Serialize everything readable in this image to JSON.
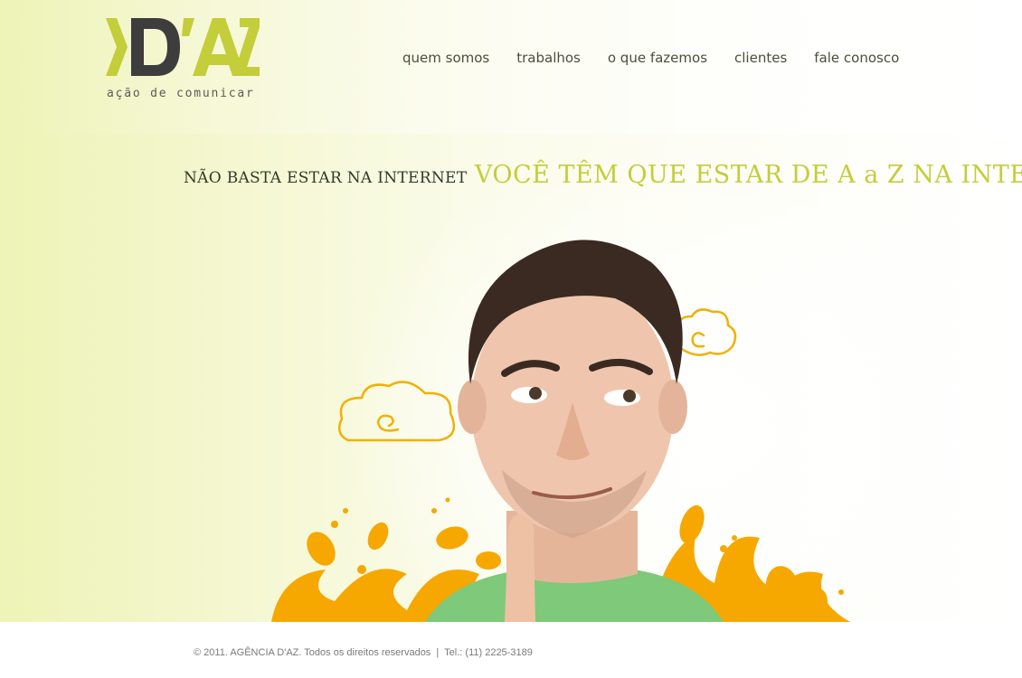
{
  "brand": {
    "logo_text": "D'AZ",
    "tagline": "ação de comunicar",
    "colors": {
      "accent": "#c4cd3a",
      "dark": "#3d3d3d",
      "orange": "#f5a400"
    }
  },
  "nav": {
    "items": [
      {
        "label": "quem somos"
      },
      {
        "label": "trabalhos"
      },
      {
        "label": "o que fazemos"
      },
      {
        "label": "clientes"
      },
      {
        "label": "fale conosco"
      }
    ]
  },
  "hero": {
    "headline_small": "NÃO BASTA ESTAR NA INTERNET",
    "headline_big": "VOCÊ TÊM QUE ESTAR DE A a Z NA INTERNET!",
    "image": "thinking-man-with-doodle-clouds-and-orange-splashes"
  },
  "footer": {
    "copyright": "© 2011. AGÊNCIA D'AZ. Todos os direitos reservados",
    "separator": "|",
    "phone": "Tel.: (11) 2225-3189"
  }
}
